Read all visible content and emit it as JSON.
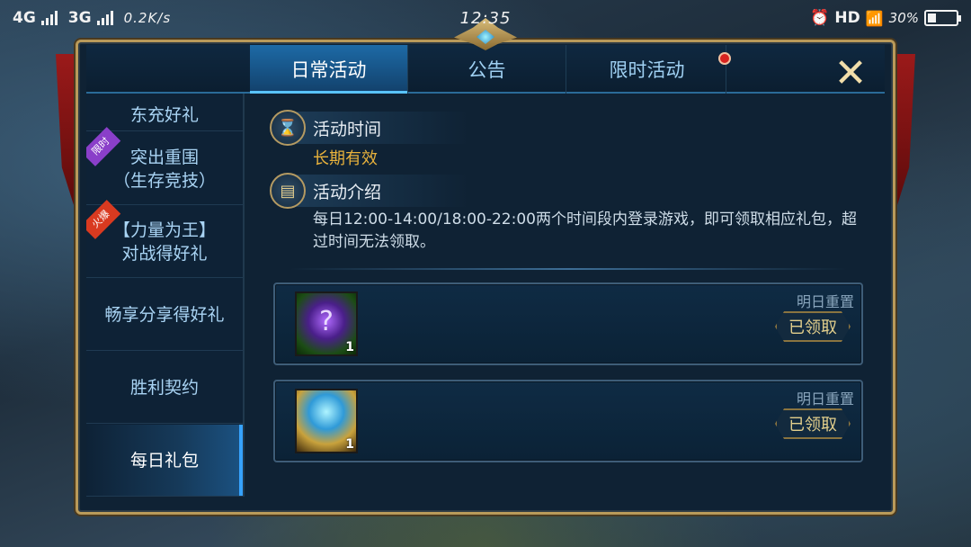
{
  "status_bar": {
    "network1": "4G",
    "network2": "3G",
    "speed": "0.2K/s",
    "time": "12:35",
    "hd": "HD",
    "battery_pct": "30%",
    "battery_level": 0.3
  },
  "tabs": [
    {
      "label": "日常活动",
      "active": true
    },
    {
      "label": "公告",
      "active": false
    },
    {
      "label": "限时活动",
      "active": false,
      "notification": true
    }
  ],
  "close_icon": "✕",
  "sidebar": {
    "items": [
      {
        "line1": "",
        "line2": "东充好礼"
      },
      {
        "line1": "突出重围",
        "line2": "（生存竞技）",
        "tag": "限时",
        "tag_color": "#8a3fc9"
      },
      {
        "line1": "【力量为王】",
        "line2": "对战得好礼",
        "tag": "火爆",
        "tag_color": "#d93a20"
      },
      {
        "line1": "畅享分享得好礼",
        "line2": ""
      },
      {
        "line1": "胜利契约",
        "line2": ""
      },
      {
        "line1": "每日礼包",
        "line2": "",
        "active": true
      }
    ]
  },
  "content": {
    "time_section": {
      "title": "活动时间",
      "icon": "hourglass-icon",
      "value": "长期有效"
    },
    "intro_section": {
      "title": "活动介绍",
      "icon": "book-icon",
      "text": "每日12:00-14:00/18:00-22:00两个时间段内登录游戏，即可领取相应礼包，超过时间无法领取。"
    },
    "rewards": [
      {
        "icon": "card-icon",
        "quantity": "1",
        "reset": "明日重置",
        "button": "已领取"
      },
      {
        "icon": "chest-icon",
        "quantity": "1",
        "reset": "明日重置",
        "button": "已领取"
      }
    ]
  }
}
